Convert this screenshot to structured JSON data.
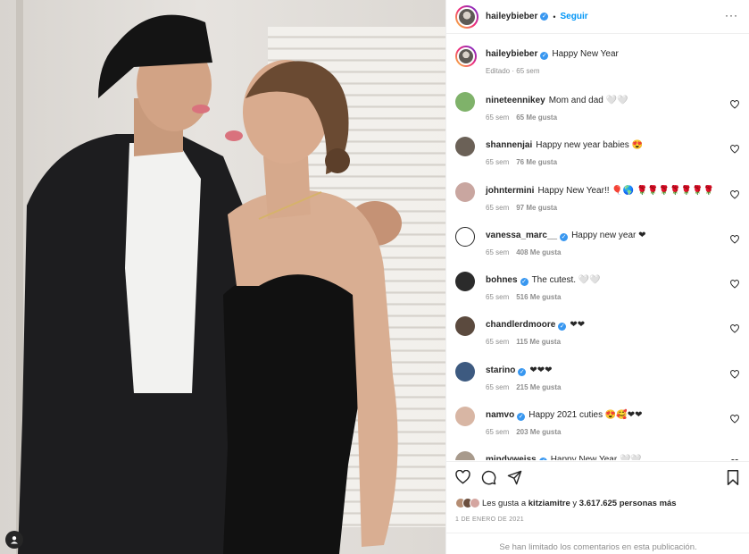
{
  "post": {
    "author": "haileybieber",
    "follow_label": "Seguir",
    "caption": "Happy New Year",
    "caption_meta": "Editado · 65 sem"
  },
  "comments": [
    {
      "user": "nineteennikey",
      "verified": false,
      "text": "Mom and dad 🤍🤍",
      "age": "65 sem",
      "likes": "65 Me gusta",
      "avatar_color": "#7fb26a"
    },
    {
      "user": "shannenjai",
      "verified": false,
      "text": "Happy new year babies 😍",
      "age": "65 sem",
      "likes": "76 Me gusta",
      "avatar_color": "#6b6157"
    },
    {
      "user": "johntermini",
      "verified": false,
      "text": "Happy New Year!! 🎈🌎 🌹🌹🌹🌹🌹🌹🌹",
      "age": "65 sem",
      "likes": "97 Me gusta",
      "avatar_color": "#c9a6a0"
    },
    {
      "user": "vanessa_marc__",
      "verified": true,
      "text": "Happy new year ❤",
      "age": "65 sem",
      "likes": "408 Me gusta",
      "avatar_color": "#ffffff"
    },
    {
      "user": "bohnes",
      "verified": true,
      "text": "The cutest. 🤍🤍",
      "age": "65 sem",
      "likes": "516 Me gusta",
      "avatar_color": "#2b2b2b"
    },
    {
      "user": "chandlerdmoore",
      "verified": true,
      "text": "❤❤",
      "age": "65 sem",
      "likes": "115 Me gusta",
      "avatar_color": "#5b4a3e"
    },
    {
      "user": "starino",
      "verified": true,
      "text": "❤❤❤",
      "age": "65 sem",
      "likes": "215 Me gusta",
      "avatar_color": "#3d5a80"
    },
    {
      "user": "namvo",
      "verified": true,
      "text": "Happy 2021 cuties 😍🥰❤❤",
      "age": "65 sem",
      "likes": "203 Me gusta",
      "avatar_color": "#d8b6a4"
    },
    {
      "user": "mindyweiss",
      "verified": true,
      "text": "Happy New Year 🤍🤍",
      "age": "",
      "likes": "",
      "avatar_color": "#a89a8c"
    }
  ],
  "likes": {
    "prefix": "Les gusta a",
    "first_user": "kitziamitre",
    "connector": "y",
    "others": "3.617.625 personas más"
  },
  "date": "1 de enero de 2021",
  "comments_limited": "Se han limitado los comentarios en esta publicación.",
  "colors": {
    "accent_blue": "#0095f6",
    "verified_blue": "#3897f0",
    "muted_text": "#8e8e8e",
    "heart_red": "#c1121f"
  },
  "icons": {
    "like": "heart-icon",
    "comment": "comment-icon",
    "share": "share-icon",
    "save": "bookmark-icon",
    "more": "more-options-icon",
    "verified": "verified-badge-icon",
    "user_tag": "user-tag-icon"
  }
}
